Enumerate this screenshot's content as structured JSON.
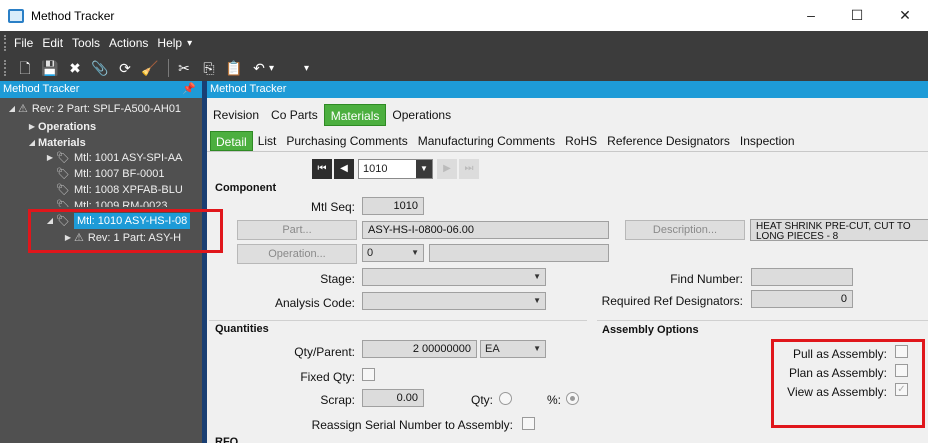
{
  "window": {
    "title": "Method Tracker",
    "minimize": "–",
    "maximize": "☐",
    "close": "✕"
  },
  "menu": {
    "items": [
      "File",
      "Edit",
      "Tools",
      "Actions",
      "Help"
    ],
    "more": "▾"
  },
  "toolbar": {
    "more": "▾"
  },
  "tree": {
    "header": "Method Tracker",
    "pin": "📌",
    "nodes": [
      {
        "label": "Rev: 2 Part: SPLF-A500-AH01"
      },
      {
        "label": "Operations"
      },
      {
        "label": "Materials"
      },
      {
        "label": "Mtl: 1001 ASY-SPI-AA"
      },
      {
        "label": "Mtl: 1007 BF-0001"
      },
      {
        "label": "Mtl: 1008 XPFAB-BLU"
      },
      {
        "label": "Mtl: 1009 RM-0023"
      },
      {
        "label": "Mtl: 1010 ASY-HS-I-08"
      },
      {
        "label": "Rev: 1 Part: ASY-H"
      }
    ]
  },
  "main": {
    "header": "Method Tracker",
    "tabs": [
      "Revision",
      "Co Parts",
      "Materials",
      "Operations"
    ],
    "subtabs": [
      "Detail",
      "List",
      "Purchasing Comments",
      "Manufacturing Comments",
      "RoHS",
      "Reference Designators",
      "Inspection"
    ],
    "nav": {
      "value": "1010"
    }
  },
  "component": {
    "title": "Component",
    "mtl_seq_label": "Mtl Seq:",
    "mtl_seq": "1010",
    "part_button": "Part...",
    "part_value": "ASY-HS-I-0800-06.00",
    "description_button": "Description...",
    "description_value": "HEAT SHRINK PRE-CUT, CUT TO LONG PIECES - 8",
    "operation_button": "Operation...",
    "operation_value": "0",
    "stage_label": "Stage:",
    "analysis_label": "Analysis Code:",
    "find_number_label": "Find Number:",
    "req_ref_label": "Required Ref Designators:",
    "req_ref_value": "0"
  },
  "quantities": {
    "title": "Quantities",
    "qty_parent_label": "Qty/Parent:",
    "qty_parent_value": "2 00000000",
    "uom": "EA",
    "fixed_qty_label": "Fixed Qty:",
    "scrap_label": "Scrap:",
    "scrap_value": "0.00",
    "qty_label": "Qty:",
    "pct_label": "%:",
    "reassign_label": "Reassign Serial Number to Assembly:"
  },
  "assembly": {
    "title": "Assembly Options",
    "pull_label": "Pull as Assembly:",
    "plan_label": "Plan as Assembly:",
    "view_label": "View as Assembly:"
  },
  "rfq": {
    "title": "RFQ"
  }
}
